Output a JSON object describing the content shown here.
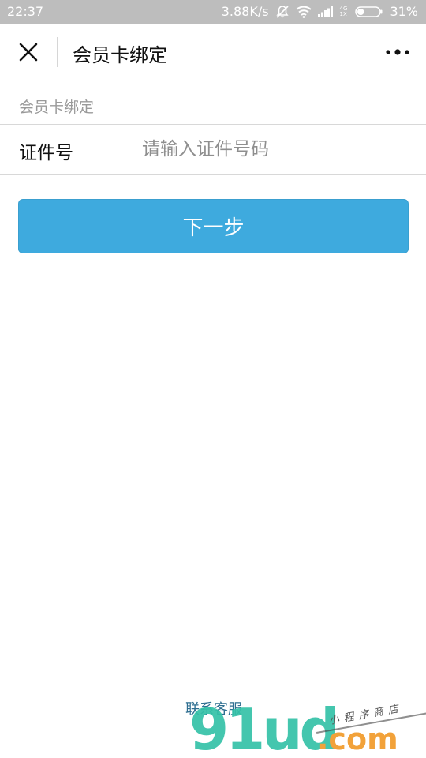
{
  "status_bar": {
    "time": "22:37",
    "speed": "3.88K/s",
    "net_top": "4G",
    "net_bottom": "1X",
    "battery": "31%",
    "battery_level": 0.31,
    "icons": [
      "bell-muted-icon",
      "wifi-icon",
      "signal-icon",
      "battery-icon"
    ]
  },
  "nav": {
    "title": "会员卡绑定",
    "close_icon": "close-icon",
    "more_icon": "more-icon"
  },
  "form": {
    "section_label": "会员卡绑定",
    "field_label": "证件号",
    "field_placeholder": "请输入证件号码",
    "field_value": ""
  },
  "actions": {
    "next_label": "下一步",
    "button_color": "#3eaade"
  },
  "footer": {
    "contact_label": "联系客服"
  },
  "watermark": {
    "brand": "91ud",
    "suffix": ".com",
    "tagline": "小程序商店"
  }
}
